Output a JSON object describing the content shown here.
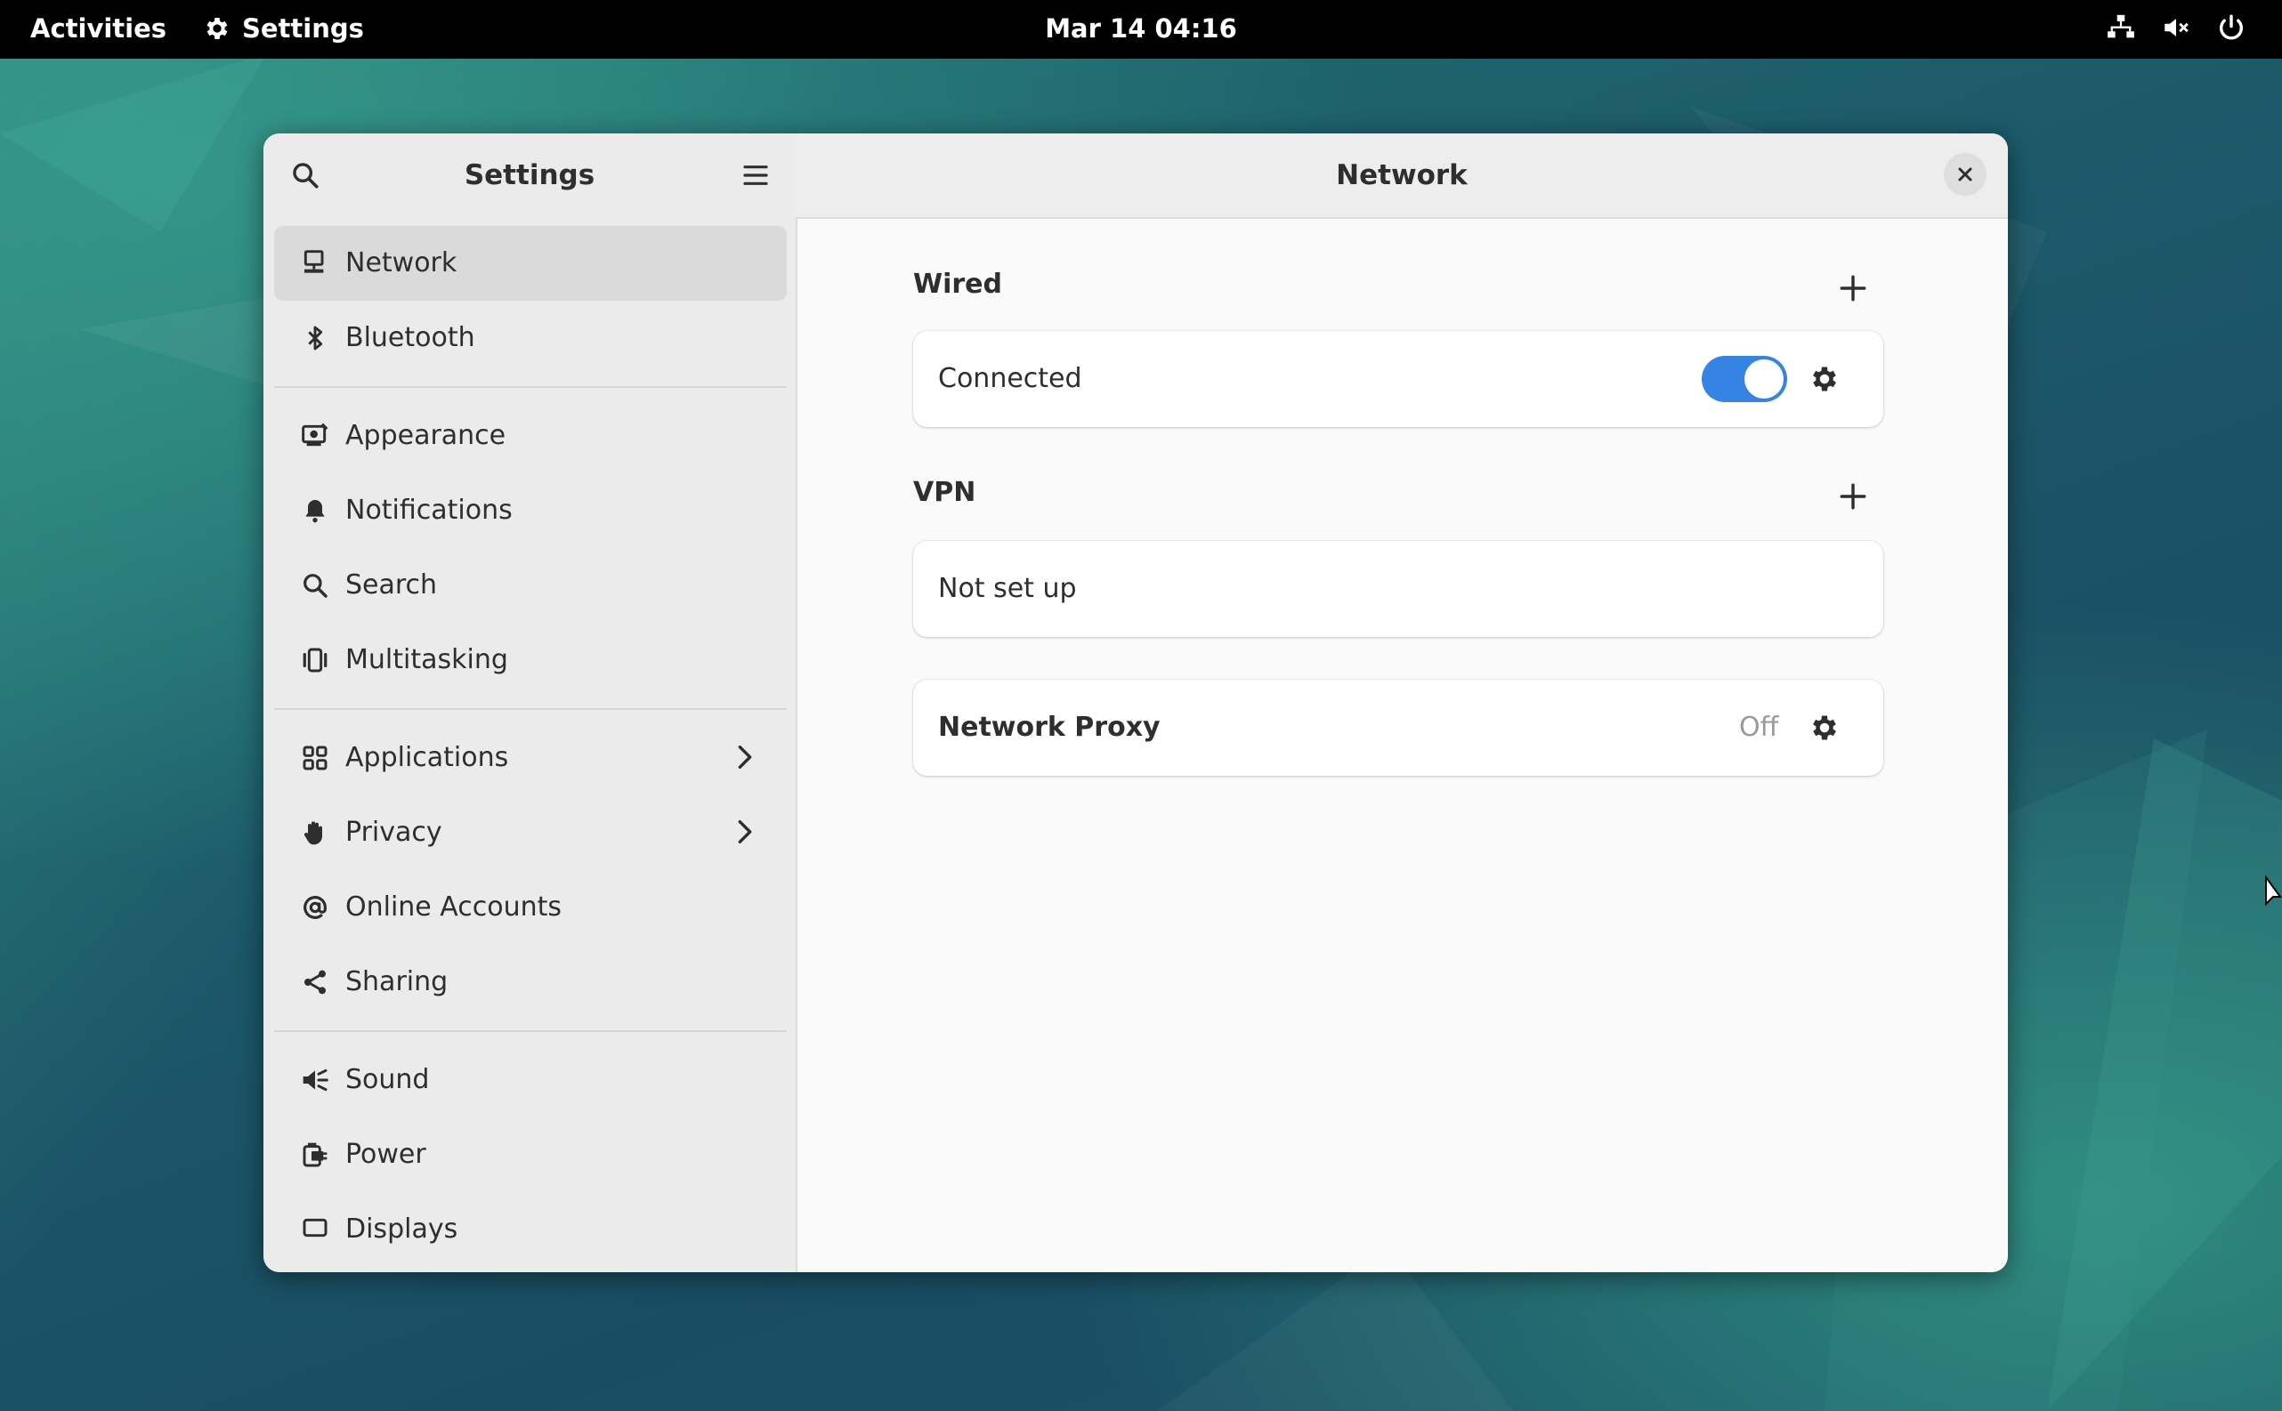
{
  "topbar": {
    "activities": "Activities",
    "app_name": "Settings",
    "clock": "Mar 14  04:16",
    "tray_icons": [
      "network-wired-icon",
      "volume-muted-icon",
      "power-icon"
    ]
  },
  "sidebar": {
    "title": "Settings",
    "items": [
      {
        "label": "Network",
        "icon": "network-icon"
      },
      {
        "label": "Bluetooth",
        "icon": "bluetooth-icon"
      },
      {
        "label": "Appearance",
        "icon": "appearance-icon"
      },
      {
        "label": "Notifications",
        "icon": "bell-icon"
      },
      {
        "label": "Search",
        "icon": "search-icon"
      },
      {
        "label": "Multitasking",
        "icon": "multitasking-icon"
      },
      {
        "label": "Applications",
        "icon": "apps-grid-icon"
      },
      {
        "label": "Privacy",
        "icon": "hand-icon"
      },
      {
        "label": "Online Accounts",
        "icon": "at-icon"
      },
      {
        "label": "Sharing",
        "icon": "share-icon"
      },
      {
        "label": "Sound",
        "icon": "speaker-icon"
      },
      {
        "label": "Power",
        "icon": "power-plug-icon"
      },
      {
        "label": "Displays",
        "icon": "display-icon"
      }
    ]
  },
  "main": {
    "title": "Network",
    "wired": {
      "title": "Wired",
      "status": "Connected",
      "enabled": true
    },
    "vpn": {
      "title": "VPN",
      "status": "Not set up"
    },
    "proxy": {
      "title": "Network Proxy",
      "status": "Off"
    }
  },
  "colors": {
    "accent": "#3584e4",
    "topbar": "#000000",
    "window_bg": "#fafafa",
    "sidebar_bg": "#ebebeb"
  }
}
